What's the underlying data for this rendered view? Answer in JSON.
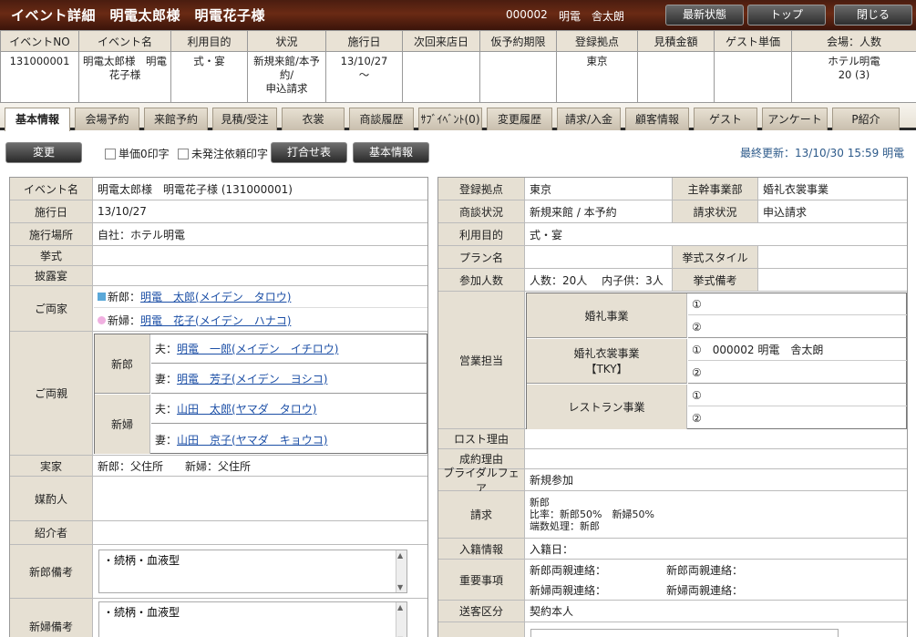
{
  "header": {
    "title": "イベント詳細　明電太郎様　明電花子様",
    "user_id": "000002",
    "user_name": "明電　舎太朗",
    "buttons": {
      "refresh": "最新状態",
      "top": "トップ",
      "close": "閉じる"
    }
  },
  "summary": {
    "headers": [
      "イベントNO",
      "イベント名",
      "利用目的",
      "状況",
      "施行日",
      "次回来店日",
      "仮予約期限",
      "登録拠点",
      "見積金額",
      "ゲスト単価",
      "会場：人数"
    ],
    "values": [
      "131000001",
      "明電太郎様　明電花子様",
      "式・宴",
      "新規来館/本予約/\n申込請求",
      "13/10/27\n～",
      "",
      "",
      "東京",
      "",
      "",
      "ホテル明電\n20 (3)"
    ]
  },
  "tabs": [
    "基本情報",
    "会場予約",
    "来館予約",
    "見積/受注",
    "衣裳",
    "商談履歴",
    "ｻﾌﾞｲﾍﾞﾝﾄ(0)",
    "変更履歴",
    "請求/入金",
    "顧客情報",
    "ゲスト",
    "アンケート",
    "P紹介"
  ],
  "actions": {
    "change": "変更",
    "unit_price_zero": "単価0印字",
    "unordered_print": "未発注依頼印字",
    "meeting_sheet": "打合せ表",
    "basic_info": "基本情報",
    "last_update": "最終更新：13/10/30 15:59 明電"
  },
  "left": {
    "event_name_label": "イベント名",
    "event_name": "明電太郎様　明電花子様 (131000001)",
    "date_label": "施行日",
    "date": "13/10/27",
    "place_label": "施行場所",
    "place": "自社：ホテル明電",
    "ceremony_label": "挙式",
    "ceremony": "",
    "reception_label": "披露宴",
    "reception": "",
    "couple_label": "ご両家",
    "groom_prefix": "新郎：",
    "groom": "明電　太郎(メイデン　タロウ)",
    "bride_prefix": "新婦：",
    "bride": "明電　花子(メイデン　ハナコ)",
    "parents_label": "ご両親",
    "groom_side": "新郎",
    "bride_side": "新婦",
    "husband_prefix": "夫：",
    "wife_prefix": "妻：",
    "g_father": "明電　一郎(メイデン　イチロウ)",
    "g_mother": "明電　芳子(メイデン　ヨシコ)",
    "b_father": "山田　太郎(ヤマダ　タロウ)",
    "b_mother": "山田　京子(ヤマダ　キョウコ)",
    "family_home_label": "実家",
    "family_home": "新郎：父住所　　新婦：父住所",
    "matchmaker_label": "媒酌人",
    "introducer_label": "紹介者",
    "groom_notes_label": "新郎備考",
    "groom_notes": "・続柄・血液型",
    "bride_notes_label": "新婦備考",
    "bride_notes": "・続柄・血液型"
  },
  "right": {
    "base_label": "登録拠点",
    "base": "東京",
    "dept_label": "主幹事業部",
    "dept": "婚礼衣裳事業",
    "negotiation_label": "商談状況",
    "negotiation": "新規来館 / 本予約",
    "billing_status_label": "請求状況",
    "billing_status": "申込請求",
    "purpose_label": "利用目的",
    "purpose": "式・宴",
    "plan_label": "プラン名",
    "plan": "",
    "style_label": "挙式スタイル",
    "style": "",
    "attendees_label": "参加人数",
    "attendees": "人数：20人　 内子供：3人",
    "ceremony_note_label": "挙式備考",
    "ceremony_note": "",
    "sales_label": "営業担当",
    "wedding_label": "婚礼事業",
    "wedding_1": "①",
    "wedding_2": "②",
    "costume_label": "婚礼衣裳事業\n【TKY】",
    "costume_1": "①　000002 明電　舎太朗",
    "costume_2": "②",
    "restaurant_label": "レストラン事業",
    "restaurant_1": "①",
    "restaurant_2": "②",
    "lost_label": "ロスト理由",
    "lost": "",
    "success_label": "成約理由",
    "success": "",
    "fair_label": "ブライダルフェア",
    "fair": "新規参加",
    "billing_label": "請求",
    "billing_1": "新郎",
    "billing_2": "比率：新郎50%　新婦50%",
    "billing_3": "端数処理：新郎",
    "registry_label": "入籍情報",
    "registry": "入籍日：",
    "important_label": "重要事項",
    "imp_g_parents": "新郎両親連絡：",
    "imp_g_parents2": "新郎両親連絡：",
    "imp_b_parents": "新婦両親連絡：",
    "imp_b_parents2": "新婦両親連絡：",
    "transfer_label": "送客区分",
    "transfer": "契約本人"
  },
  "colors": {
    "header_bg": "#5a2312",
    "label_bg": "#e6e0d3",
    "link": "#1c4fa6",
    "groom_square": "#5aa8d8",
    "bride_dot": "#f0b0e0"
  }
}
